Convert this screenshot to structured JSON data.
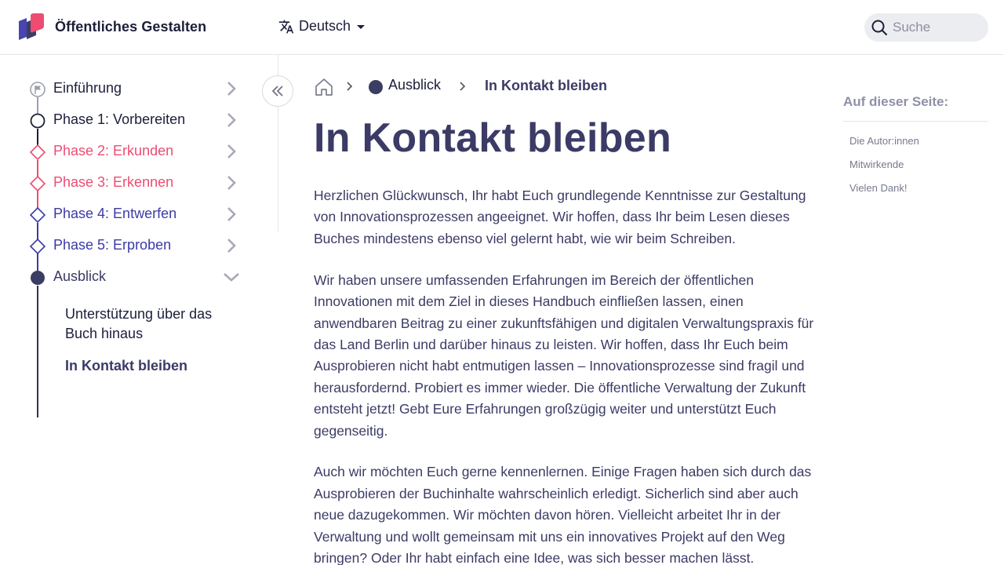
{
  "header": {
    "site_title": "Öffentliches Gestalten",
    "language": "Deutsch",
    "search_placeholder": "Suche",
    "brand_colors": {
      "pink": "#ee4c71",
      "navy": "#3b3d63",
      "indigo": "#4a44b0"
    }
  },
  "sidebar": {
    "items": [
      {
        "label": "Einführung",
        "icon": "flag-icon",
        "color": "#1c1e3a",
        "expanded": false
      },
      {
        "label": "Phase 1: Vorbereiten",
        "icon": "circle-icon",
        "color": "#1c1e3a",
        "expanded": false
      },
      {
        "label": "Phase 2: Erkunden",
        "icon": "diamond-icon",
        "color": "#ee4c71",
        "expanded": false
      },
      {
        "label": "Phase 3: Erkennen",
        "icon": "diamond-icon",
        "color": "#ee4c71",
        "expanded": false
      },
      {
        "label": "Phase 4: Entwerfen",
        "icon": "diamond-icon",
        "color": "#3c3aa6",
        "expanded": false
      },
      {
        "label": "Phase 5: Erproben",
        "icon": "diamond-icon",
        "color": "#3c3aa6",
        "expanded": false
      },
      {
        "label": "Ausblick",
        "icon": "filled-circle-icon",
        "color": "#3b3b66",
        "expanded": true
      }
    ],
    "sub_items": [
      {
        "label": "Unterstützung über das Buch hinaus",
        "active": false
      },
      {
        "label": "In Kontakt bleiben",
        "active": true
      }
    ],
    "collapse_icon": "double-chevron-left-icon"
  },
  "breadcrumb": {
    "home_icon": "home-icon",
    "parent": "Ausblick",
    "current": "In Kontakt bleiben"
  },
  "main": {
    "title": "In Kontakt bleiben",
    "paragraphs": [
      "Herzlichen Glückwunsch, Ihr habt Euch grundlegende Kenntnisse zur Gestaltung von Innovationsprozessen angeeignet. Wir hoffen, dass Ihr beim Lesen dieses Buches mindestens ebenso viel gelernt habt, wie wir beim Schreiben.",
      "Wir haben unsere umfassenden Erfahrungen im Bereich der öffentlichen Innovationen mit dem Ziel in dieses Handbuch einfließen lassen, einen anwendbaren Beitrag zu einer zukunftsfähigen und digitalen Verwaltungspraxis für das Land Berlin und darüber hinaus zu leisten. Wir hoffen, dass Ihr Euch beim Ausprobieren nicht habt entmutigen lassen – Innovationsprozesse sind fragil und herausfordernd. Probiert es immer wieder. Die öffentliche Verwaltung der Zukunft entsteht jetzt! Gebt Eure Erfahrungen großzügig weiter und unterstützt Euch gegenseitig.",
      "Auch wir möchten Euch gerne kennenlernen. Einige Fragen haben sich durch das Ausprobieren der Buchinhalte wahrscheinlich erledigt. Sicherlich sind aber auch neue dazugekommen. Wir möchten davon hören. Vielleicht arbeitet Ihr in der Verwaltung und wollt gemeinsam mit uns ein innovatives Projekt auf den Weg bringen? Oder Ihr habt einfach eine Idee, was sich besser machen lässt."
    ]
  },
  "toc": {
    "title": "Auf dieser Seite:",
    "links": [
      "Die Autor:innen",
      "Mitwirkende",
      "Vielen Dank!"
    ]
  }
}
